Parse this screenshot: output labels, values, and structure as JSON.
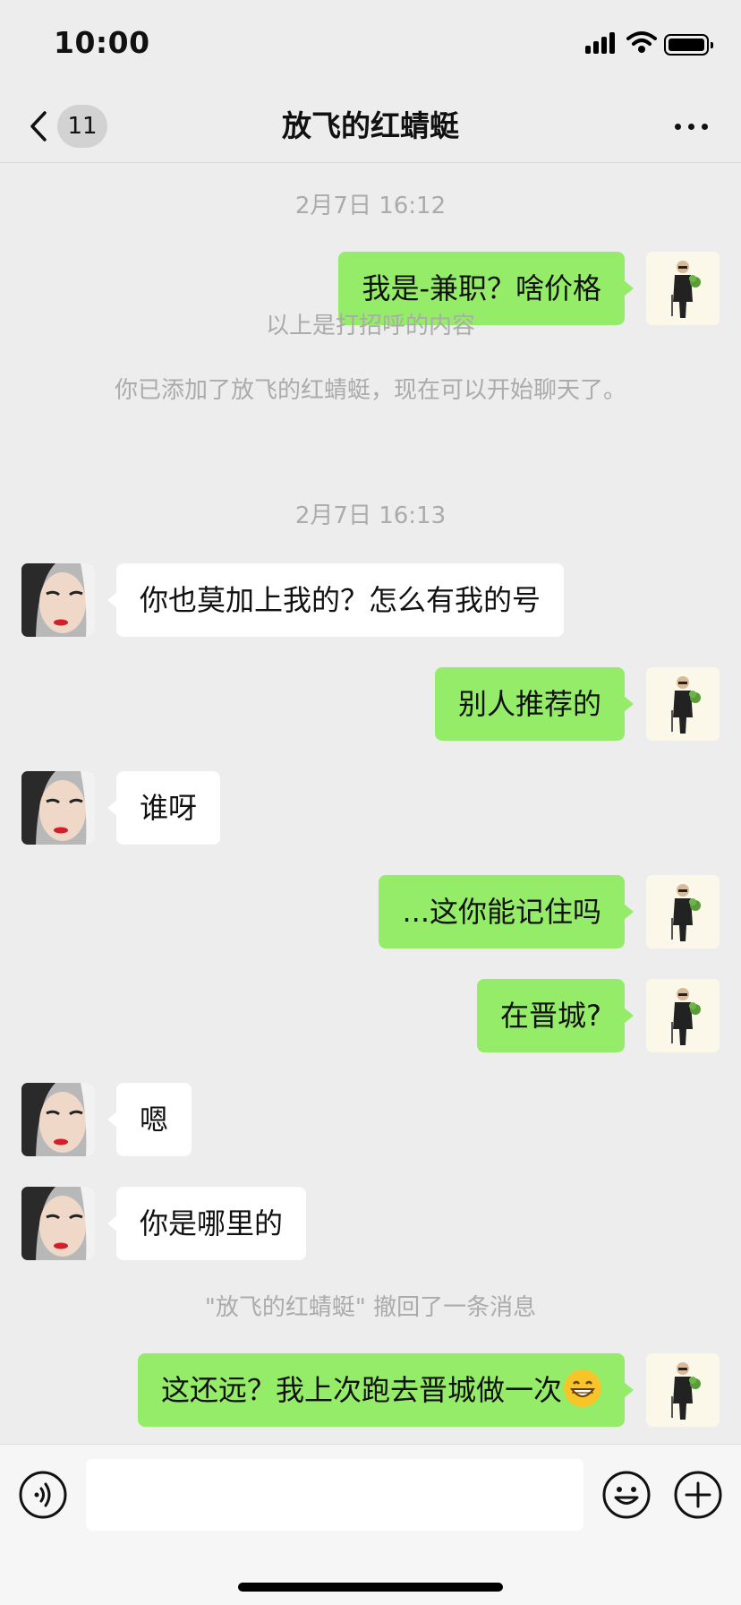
{
  "status_bar": {
    "time": "10:00"
  },
  "nav": {
    "unread_count": "11",
    "title": "放飞的红蜻蜓"
  },
  "chat": {
    "timestamp_1": "2月7日 16:12",
    "greeting_note": "以上是打招呼的内容",
    "added_note": "你已添加了放飞的红蜻蜓，现在可以开始聊天了。",
    "timestamp_2": "2月7日 16:13",
    "recall_note": "\"放飞的红蜻蜓\" 撤回了一条消息",
    "messages": [
      {
        "side": "right",
        "text": "我是-兼职？啥价格"
      },
      {
        "side": "left",
        "text": "你也莫加上我的？怎么有我的号"
      },
      {
        "side": "right",
        "text": "别人推荐的"
      },
      {
        "side": "left",
        "text": "谁呀"
      },
      {
        "side": "right",
        "text": "...这你能记住吗"
      },
      {
        "side": "right",
        "text": "在晋城?"
      },
      {
        "side": "left",
        "text": "嗯"
      },
      {
        "side": "left",
        "text": "你是哪里的"
      },
      {
        "side": "right",
        "text": "这还远？我上次跑去晋城做一次",
        "emoji": "grinning-face"
      }
    ]
  },
  "input": {
    "placeholder": ""
  },
  "colors": {
    "background": "#ededed",
    "sent_bubble": "#95ec69",
    "received_bubble": "#ffffff",
    "system_text": "#ababab"
  }
}
